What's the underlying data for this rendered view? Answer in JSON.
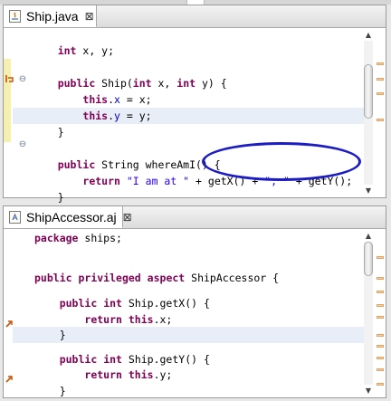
{
  "editors": [
    {
      "tab": {
        "label": "Ship.java",
        "close": "⊠"
      },
      "lines": [
        [
          [
            "t",
            "    "
          ],
          [
            "kw",
            "int"
          ],
          [
            "t",
            " x, y;"
          ]
        ],
        [],
        [
          [
            "t",
            "    "
          ],
          [
            "kw",
            "public"
          ],
          [
            "t",
            " Ship("
          ],
          [
            "kw",
            "int"
          ],
          [
            "t",
            " x, "
          ],
          [
            "kw",
            "int"
          ],
          [
            "t",
            " y) {"
          ]
        ],
        [
          [
            "t",
            "        "
          ],
          [
            "kw",
            "this"
          ],
          [
            "t",
            "."
          ],
          [
            "fld",
            "x"
          ],
          [
            "t",
            " = x;"
          ]
        ],
        [
          [
            "t",
            "        "
          ],
          [
            "kw",
            "this"
          ],
          [
            "t",
            "."
          ],
          [
            "fld",
            "y"
          ],
          [
            "t",
            " = y;"
          ]
        ],
        [
          [
            "t",
            "    }"
          ]
        ],
        [],
        [
          [
            "t",
            "    "
          ],
          [
            "kw",
            "public"
          ],
          [
            "t",
            " String whereAmI() {"
          ]
        ],
        [
          [
            "t",
            "        "
          ],
          [
            "kw",
            "return"
          ],
          [
            "t",
            " "
          ],
          [
            "str",
            "\"I am at \""
          ],
          [
            "t",
            " + getX() + "
          ],
          [
            "str",
            "\", \""
          ],
          [
            "t",
            " + getY();"
          ]
        ],
        [
          [
            "t",
            "    }"
          ]
        ]
      ]
    },
    {
      "tab": {
        "label": "ShipAccessor.aj",
        "close": "⊠"
      },
      "lines": [
        [
          [
            "kw",
            "package"
          ],
          [
            "t",
            " ships;"
          ]
        ],
        [],
        [],
        [
          [
            "kw",
            "public"
          ],
          [
            "t",
            " "
          ],
          [
            "kw",
            "privileged"
          ],
          [
            "t",
            " "
          ],
          [
            "kw",
            "aspect"
          ],
          [
            "t",
            " ShipAccessor {"
          ]
        ],
        [],
        [
          [
            "t",
            "    "
          ],
          [
            "kw",
            "public"
          ],
          [
            "t",
            " "
          ],
          [
            "kw",
            "int"
          ],
          [
            "t",
            " Ship.getX() {"
          ]
        ],
        [
          [
            "t",
            "        "
          ],
          [
            "kw",
            "return"
          ],
          [
            "t",
            " "
          ],
          [
            "kw",
            "this"
          ],
          [
            "t",
            ".x;"
          ]
        ],
        [
          [
            "t",
            "    }"
          ]
        ],
        [],
        [
          [
            "t",
            "    "
          ],
          [
            "kw",
            "public"
          ],
          [
            "t",
            " "
          ],
          [
            "kw",
            "int"
          ],
          [
            "t",
            " Ship.getY() {"
          ]
        ],
        [
          [
            "t",
            "        "
          ],
          [
            "kw",
            "return"
          ],
          [
            "t",
            " "
          ],
          [
            "kw",
            "this"
          ],
          [
            "t",
            ".y;"
          ]
        ],
        [
          [
            "t",
            "    }"
          ]
        ]
      ]
    }
  ],
  "colors": {
    "keyword": "#7f0055",
    "field": "#0000c0",
    "string": "#2a00ff",
    "annotation_ellipse": "#1c1cc4",
    "overview_marker": "#f3cfa7",
    "current_line": "#e8eef8"
  },
  "icons": {
    "tab": "java-file-icon",
    "tab2": "aspect-file-icon",
    "gutter_advised": "advice-marker-icon",
    "gutter_advice": "advice-arrow-icon",
    "fold": "fold-collapse-icon"
  }
}
